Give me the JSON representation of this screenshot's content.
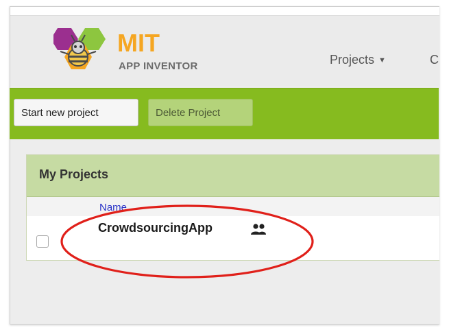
{
  "header": {
    "logo_title": "MIT",
    "logo_subtitle": "APP INVENTOR",
    "logo_icon": "bee-icon",
    "nav": {
      "projects_label": "Projects",
      "next_menu_partial": "C"
    }
  },
  "toolbar": {
    "start_new_label": "Start new project",
    "delete_label": "Delete Project"
  },
  "projects_panel": {
    "title": "My Projects",
    "columns": [
      "Name"
    ],
    "rows": [
      {
        "name": "CrowdsourcingApp",
        "shared_icon": "people-icon",
        "checked": false
      }
    ]
  },
  "colors": {
    "accent_green": "#86bb1f",
    "panel_header": "#c6dba3",
    "logo_orange": "#f5a622",
    "link_blue": "#2a33c8",
    "annotation_red": "#e0201a"
  }
}
